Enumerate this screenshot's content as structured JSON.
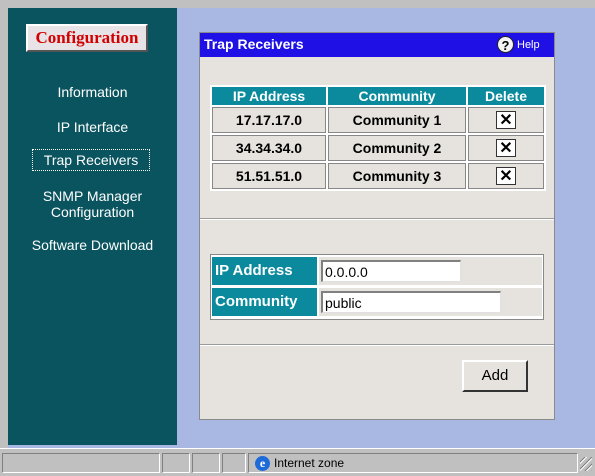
{
  "sidebar": {
    "section_tab": "Configuration",
    "items": [
      {
        "label": "Information"
      },
      {
        "label": "IP Interface"
      },
      {
        "label": "Trap Receivers"
      },
      {
        "label": "SNMP Manager Configuration"
      },
      {
        "label": "Software Download"
      }
    ]
  },
  "panel": {
    "title": "Trap Receivers",
    "help_label": "Help",
    "help_icon": "help-icon"
  },
  "trap_table": {
    "headers": [
      "IP Address",
      "Community",
      "Delete"
    ],
    "rows": [
      {
        "ip": "17.17.17.0",
        "community": "Community 1",
        "delete_icon": "x-icon"
      },
      {
        "ip": "34.34.34.0",
        "community": "Community 2",
        "delete_icon": "x-icon"
      },
      {
        "ip": "51.51.51.0",
        "community": "Community 3",
        "delete_icon": "x-icon"
      }
    ]
  },
  "form": {
    "ip_label": "IP Address",
    "ip_value": "0.0.0.0",
    "community_label": "Community",
    "community_value": "public",
    "add_label": "Add"
  },
  "statusbar": {
    "zone_text": "Internet zone",
    "zone_icon": "ie-icon"
  },
  "colors": {
    "sidebar_bg": "#0a545f",
    "header_bg": "#1f10e6",
    "table_header_bg": "#0a8a9c",
    "config_text": "#d20000",
    "page_bg": "#a9b7e3"
  }
}
